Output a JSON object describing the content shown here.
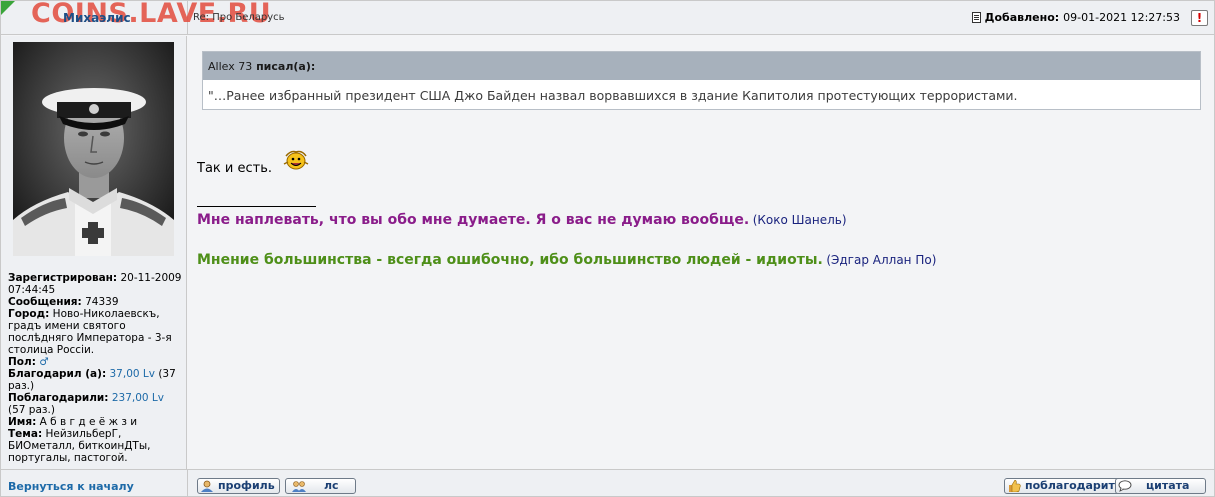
{
  "header": {
    "watermark": "COINS.LAVE.RU",
    "author": "Михаэлис",
    "subject": "Re: Про Беларусь",
    "added_label": "Добавлено:",
    "added_date": "09-01-2021 12:27:53",
    "report_glyph": "!"
  },
  "user": {
    "registered_label": "Зарегистрирован:",
    "registered_value": "20-11-2009 07:44:45",
    "posts_label": "Сообщения:",
    "posts_value": "74339",
    "city_label": "Город:",
    "city_value": "Ново-Николаевскъ, градъ имени святого послѣдняго Императора - 3-я столица Россіи.",
    "gender_label": "Пол:",
    "gender_glyph": "♂",
    "thanked_label": "Благодарил (а):",
    "thanked_link": "37,00 Lv",
    "thanked_times": "(37 раз.)",
    "thanked_by_label": "Поблагодарили:",
    "thanked_by_link": "237,00 Lv",
    "thanked_by_times": "(57 раз.)",
    "name_label": "Имя:",
    "name_value": "А б в г д е ё ж з и",
    "topic_label": "Тема:",
    "topic_value": "НейзильберГ, БИОметалл, биткоинДТы, португалы, пастогой."
  },
  "post": {
    "quote_author": "Allex 73",
    "quote_suffix": "писал(а):",
    "quote_text": "\"…Ранее избранный президент США Джо Байден назвал ворвавшихся в здание Капитолия протестующих террористами.",
    "body_text": "Так и есть.",
    "sig1_quote": "Мне наплевать, что вы обо мне думаете. Я о вас не думаю вообще.",
    "sig1_author": "(Коко Шанель)",
    "sig2_quote": "Мнение большинства - всегда ошибочно, ибо большинство людей - идиоты.",
    "sig2_author": "(Эдгар Аллан По)"
  },
  "footer": {
    "back_to_top": "Вернуться к началу",
    "profile_label": "профиль",
    "pm_label": "лс",
    "thank_label": "поблагодарить",
    "quote_label": "цитата"
  },
  "colors": {
    "accent_link": "#1d6aa8",
    "sig1": "#8a1c8a",
    "sig2": "#4e8f19",
    "watermark": "#e34c3e"
  }
}
